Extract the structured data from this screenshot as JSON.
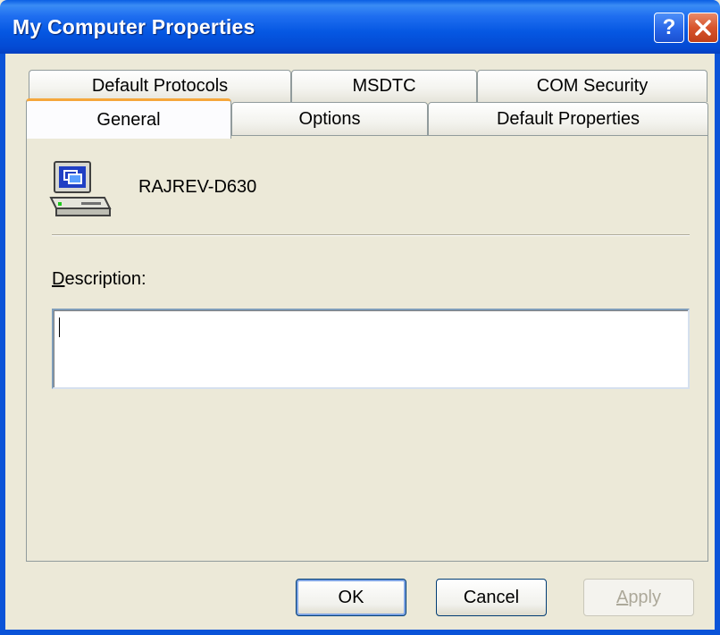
{
  "window": {
    "title": "My Computer Properties"
  },
  "tabs": {
    "row1": [
      "Default Protocols",
      "MSDTC",
      "COM Security"
    ],
    "row2": [
      "General",
      "Options",
      "Default Properties"
    ],
    "active": "General"
  },
  "general": {
    "computer_name": "RAJREV-D630",
    "computer_icon": "computer-icon",
    "description_label_accel": "D",
    "description_label_rest": "escription:",
    "description_value": ""
  },
  "buttons": {
    "ok": "OK",
    "cancel": "Cancel",
    "apply_accel": "A",
    "apply_rest": "pply"
  },
  "colors": {
    "titlebar": "#0a5ee4",
    "active_tab_accent": "#f5a73c",
    "dialog_bg": "#ece9d8"
  }
}
